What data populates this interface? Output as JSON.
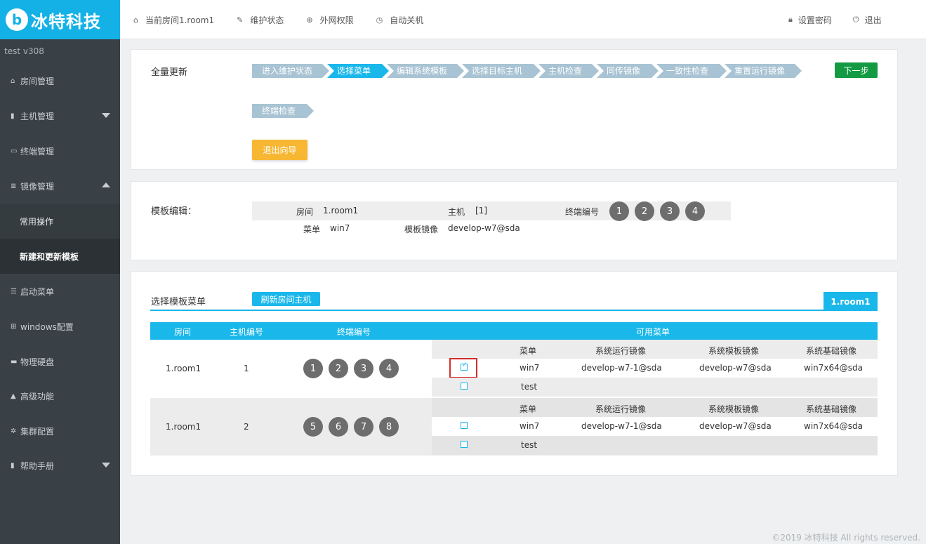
{
  "brand": {
    "logo_mark": "b",
    "name": "冰特科技"
  },
  "topnav": {
    "left": [
      {
        "icon": "home-icon",
        "glyph": "⌂",
        "label": "当前房间1.room1"
      },
      {
        "icon": "wrench-icon",
        "glyph": "✎",
        "label": "维护状态"
      },
      {
        "icon": "globe-icon",
        "glyph": "⊕",
        "label": "外网权限"
      },
      {
        "icon": "clock-icon",
        "glyph": "◷",
        "label": "自动关机"
      }
    ],
    "right": [
      {
        "icon": "lock-icon",
        "glyph": "🔒︎",
        "label": "设置密码"
      },
      {
        "icon": "power-icon",
        "glyph": "⏻",
        "label": "退出"
      }
    ]
  },
  "sidebar": {
    "version": "test  v308",
    "items": [
      {
        "icon": "home-icon",
        "glyph": "⌂",
        "label": "房间管理"
      },
      {
        "icon": "server-icon",
        "glyph": "▮",
        "label": "主机管理",
        "caret": "down"
      },
      {
        "icon": "monitor-icon",
        "glyph": "▭",
        "label": "终端管理"
      },
      {
        "icon": "database-icon",
        "glyph": "≣",
        "label": "镜像管理",
        "caret": "up"
      },
      {
        "icon": "list-icon",
        "glyph": "☰",
        "label": "启动菜单"
      },
      {
        "icon": "windows-icon",
        "glyph": "⊞",
        "label": "windows配置"
      },
      {
        "icon": "harddisk-icon",
        "glyph": "▬",
        "label": "物理硬盘"
      },
      {
        "icon": "warning-icon",
        "glyph": "▲",
        "label": "高级功能"
      },
      {
        "icon": "gear-icon",
        "glyph": "✲",
        "label": "集群配置"
      },
      {
        "icon": "book-icon",
        "glyph": "▮",
        "label": "帮助手册",
        "caret": "down"
      }
    ],
    "sub_items": [
      {
        "label": "常用操作",
        "active": false
      },
      {
        "label": "新建和更新模板",
        "active": true
      }
    ]
  },
  "wizard": {
    "title": "全量更新",
    "steps": [
      "进入维护状态",
      "选择菜单",
      "编辑系统模板",
      "选择目标主机",
      "主机检查",
      "同传镜像",
      "一致性检查",
      "重置运行镜像",
      "终端检查"
    ],
    "active_step": 1,
    "next_label": "下一步",
    "exit_label": "退出向导"
  },
  "template_edit": {
    "title": "模板编辑：",
    "room_label": "房间",
    "room_value": "1.room1",
    "host_label": "主机",
    "host_value": "[1]",
    "terminal_label": "终端编号",
    "terminals": [
      "1",
      "2",
      "3",
      "4"
    ],
    "menu_label": "菜单",
    "menu_value": "win7",
    "image_label": "模板镜像",
    "image_value": "develop-w7@sda"
  },
  "menu_select": {
    "title": "选择模板菜单",
    "refresh_label": "刷新房间主机",
    "room_tab": "1.room1",
    "headers": {
      "room": "房间",
      "host": "主机编号",
      "terminal": "终端编号",
      "menus": "可用菜单"
    },
    "sub_headers": {
      "menu": "菜单",
      "run_image": "系统运行镜像",
      "template_image": "系统模板镜像",
      "base_image": "系统基础镜像"
    },
    "rows": [
      {
        "room": "1.room1",
        "host": "1",
        "terminals": [
          "1",
          "2",
          "3",
          "4"
        ],
        "menus": [
          {
            "checked": true,
            "name": "win7",
            "run_image": "develop-w7-1@sda",
            "template_image": "develop-w7@sda",
            "base_image": "win7x64@sda"
          },
          {
            "checked": false,
            "name": "test",
            "run_image": "",
            "template_image": "",
            "base_image": ""
          }
        ]
      },
      {
        "room": "1.room1",
        "host": "2",
        "terminals": [
          "5",
          "6",
          "7",
          "8"
        ],
        "menus": [
          {
            "checked": false,
            "name": "win7",
            "run_image": "develop-w7-1@sda",
            "template_image": "develop-w7@sda",
            "base_image": "win7x64@sda"
          },
          {
            "checked": false,
            "name": "test",
            "run_image": "",
            "template_image": "",
            "base_image": ""
          }
        ]
      }
    ]
  },
  "footer": "©2019 冰特科技 All rights reserved.",
  "colors": {
    "brand": "#14b1e6",
    "sidebar": "#3a4146",
    "accent": "#1ab7ea",
    "step_inactive": "#a8c3d3",
    "next_button": "#139a43",
    "exit_button": "#f7b733",
    "highlight_box": "#d62b2b"
  }
}
